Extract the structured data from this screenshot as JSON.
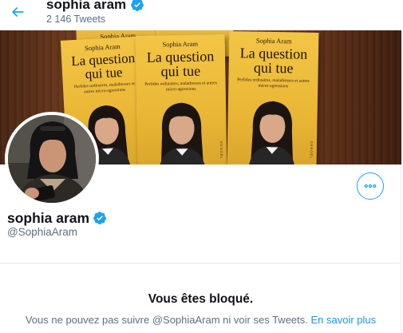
{
  "header": {
    "name": "sophia aram",
    "tweet_count": "2 146 Tweets",
    "back_icon": "arrow-left-icon",
    "accent_color": "#1da1f2"
  },
  "banner": {
    "books": [
      {
        "author": "Sophia Aram",
        "title_line1": "La question",
        "title_line2": "qui tue",
        "subtitle": "Perfides ordinaires, maladresses et autres micro-agressions"
      },
      {
        "author": "Sophia Aram",
        "title_line1": "La question",
        "title_line2": "qui tue",
        "subtitle": "Perfides ordinaires, maladresses et autres micro-agressions"
      },
      {
        "author": "Sophia Aram",
        "title_line1": "La question",
        "title_line2": "qui tue",
        "subtitle": "Perfides ordinaires, maladresses et autres micro-agressions"
      }
    ],
    "spine_text": "DENOËL"
  },
  "profile": {
    "name": "sophia aram",
    "handle": "@SophiaAram",
    "verified_icon": "verified-badge-icon",
    "more_icon": "more-options-icon"
  },
  "blocked": {
    "title": "Vous êtes bloqué.",
    "text": "Vous ne pouvez pas suivre @SophiaAram ni voir ses Tweets.",
    "link": "En savoir plus"
  }
}
